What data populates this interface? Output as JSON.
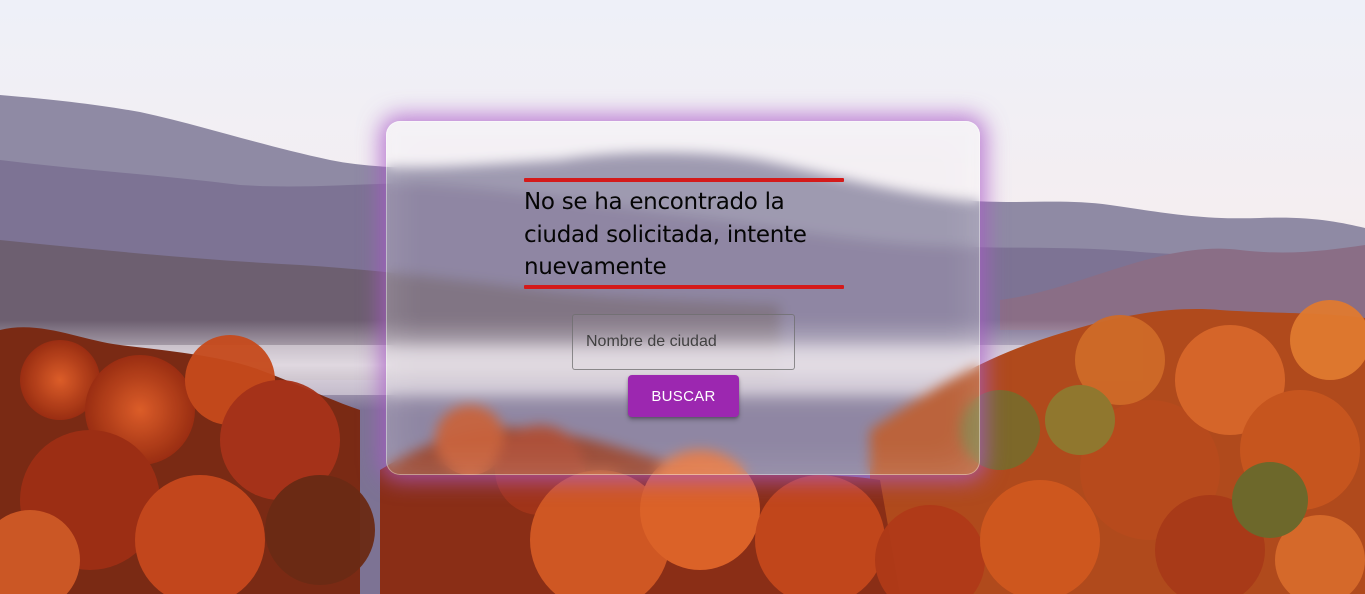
{
  "background": {
    "description_icon": "autumn-mountain-landscape-image"
  },
  "search_card": {
    "error_message": "No se ha encontrado la ciudad solicitada, intente nuevamente",
    "input": {
      "placeholder": "Nombre de ciudad",
      "value": ""
    },
    "button_label": "BUSCAR"
  },
  "colors": {
    "error_rule": "#d41a1a",
    "button_bg": "#9c27b0",
    "card_glow": "#aa5ac8"
  }
}
